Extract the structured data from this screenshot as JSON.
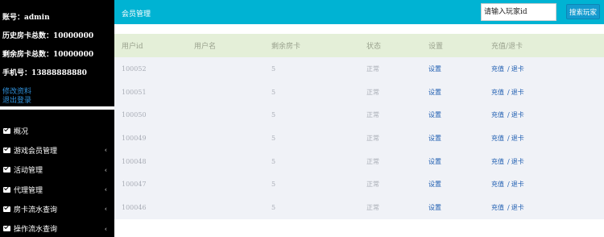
{
  "account": {
    "username_line": "账号：admin",
    "history_cards_line": "历史房卡总数：10000000",
    "remaining_cards_line": "剩余房卡总数：10000000",
    "phone_line": "手机号：13888888880",
    "edit_profile": "修改资料",
    "logout": "退出登录"
  },
  "menu": [
    {
      "label": "概况",
      "icon": "envelope-icon",
      "has_arrow": false
    },
    {
      "label": "游戏会员管理",
      "icon": "envelope-icon",
      "has_arrow": true,
      "arrow": "‹"
    },
    {
      "label": "活动管理",
      "icon": "envelope-icon",
      "has_arrow": true,
      "arrow": "‹"
    },
    {
      "label": "代理管理",
      "icon": "envelope-icon",
      "has_arrow": true,
      "arrow": "‹"
    },
    {
      "label": "房卡流水查询",
      "icon": "envelope-icon",
      "has_arrow": true,
      "arrow": "‹"
    },
    {
      "label": "操作流水查询",
      "icon": "envelope-icon",
      "has_arrow": true,
      "arrow": "‹"
    }
  ],
  "header": {
    "title": "会员管理",
    "search_placeholder": "请输入玩家id",
    "search_button": "搜索玩家"
  },
  "table": {
    "columns": [
      "用户id",
      "用户名",
      "剩余房卡",
      "状态",
      "设置",
      "充值/退卡"
    ],
    "rows": [
      {
        "id": "100052",
        "name": "",
        "cards": "5",
        "status": "正常",
        "setting": "设置",
        "recharge": "充值",
        "sep": "/",
        "refund": "退卡"
      },
      {
        "id": "100051",
        "name": "",
        "cards": "5",
        "status": "正常",
        "setting": "设置",
        "recharge": "充值",
        "sep": "/",
        "refund": "退卡"
      },
      {
        "id": "100050",
        "name": "",
        "cards": "5",
        "status": "正常",
        "setting": "设置",
        "recharge": "充值",
        "sep": "/",
        "refund": "退卡"
      },
      {
        "id": "100049",
        "name": "",
        "cards": "5",
        "status": "正常",
        "setting": "设置",
        "recharge": "充值",
        "sep": "/",
        "refund": "退卡"
      },
      {
        "id": "100048",
        "name": "",
        "cards": "5",
        "status": "正常",
        "setting": "设置",
        "recharge": "充值",
        "sep": "/",
        "refund": "退卡"
      },
      {
        "id": "100047",
        "name": "",
        "cards": "5",
        "status": "正常",
        "setting": "设置",
        "recharge": "充值",
        "sep": "/",
        "refund": "退卡"
      },
      {
        "id": "100046",
        "name": "",
        "cards": "5",
        "status": "正常",
        "setting": "设置",
        "recharge": "充值",
        "sep": "/",
        "refund": "退卡"
      }
    ]
  },
  "colors": {
    "sidebar_bg": "#000000",
    "header_bg": "#00b3d3",
    "table_header_bg": "#e4efd8",
    "table_body_bg": "#f0f2f7",
    "link": "#1f5eb1",
    "account_link": "#2f8fd8",
    "search_button_bg": "#149bcf"
  }
}
